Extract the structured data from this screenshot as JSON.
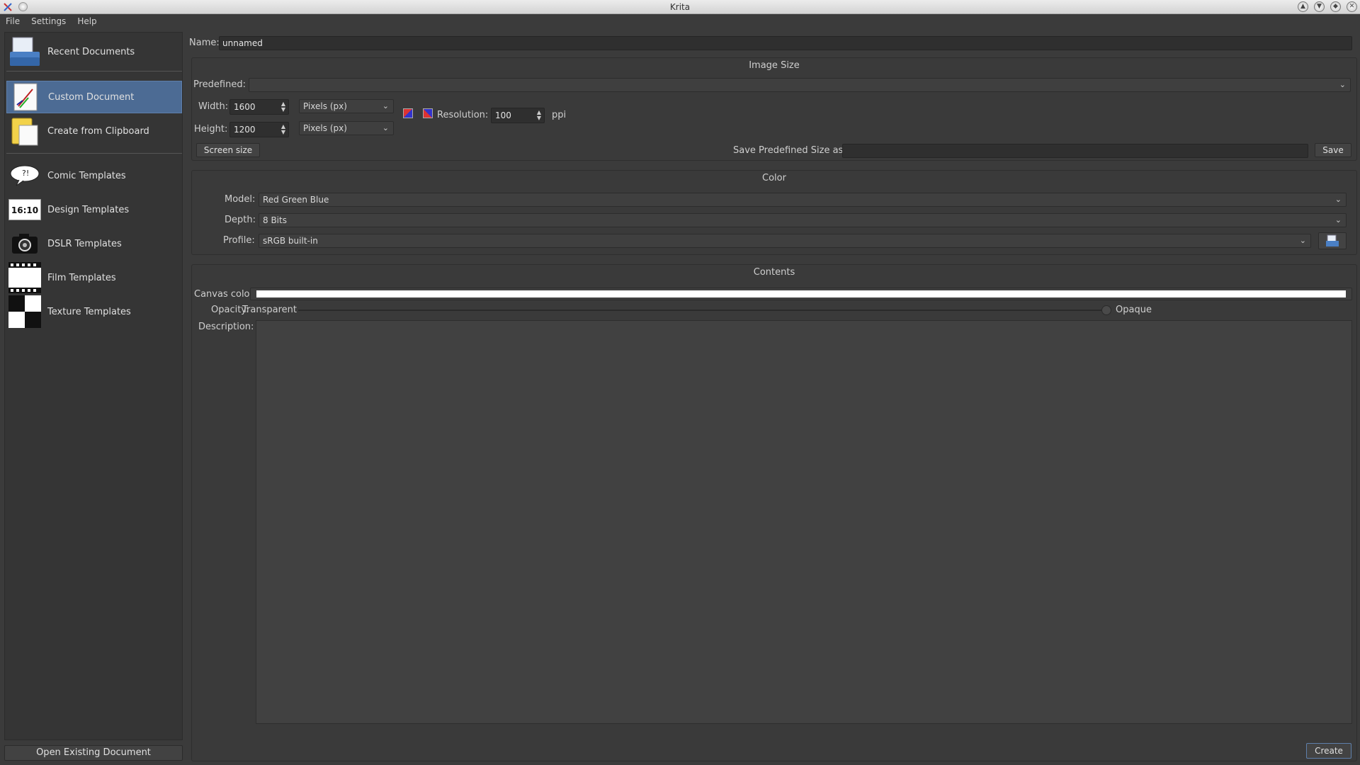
{
  "window": {
    "title": "Krita"
  },
  "menu": [
    "File",
    "Settings",
    "Help"
  ],
  "sidebar": {
    "items": [
      {
        "label": "Recent Documents",
        "icon": "documents-icon"
      },
      {
        "label": "Custom Document",
        "icon": "custom-document-icon",
        "selected": true
      },
      {
        "label": "Create from Clipboard",
        "icon": "clipboard-icon"
      },
      {
        "label": "Comic Templates",
        "icon": "speech-bubble-icon"
      },
      {
        "label": "Design Templates",
        "icon": "aspect-ratio-icon",
        "icon_text": "16:10"
      },
      {
        "label": "DSLR Templates",
        "icon": "camera-icon"
      },
      {
        "label": "Film Templates",
        "icon": "film-strip-icon"
      },
      {
        "label": "Texture Templates",
        "icon": "checkerboard-icon"
      }
    ],
    "open_existing": "Open Existing Document"
  },
  "form": {
    "name_label": "Name:",
    "name_value": "unnamed",
    "image_size": {
      "heading": "Image Size",
      "predefined_label": "Predefined:",
      "predefined_value": "",
      "width_label": "Width:",
      "width_value": "1600",
      "width_unit": "Pixels (px)",
      "height_label": "Height:",
      "height_value": "1200",
      "height_unit": "Pixels (px)",
      "resolution_label": "Resolution:",
      "resolution_value": "100",
      "resolution_unit": "ppi",
      "screen_size_button": "Screen size",
      "save_predefined_label": "Save Predefined Size as:",
      "save_predefined_value": "",
      "save_button": "Save"
    },
    "color": {
      "heading": "Color",
      "model_label": "Model:",
      "model_value": "Red Green Blue",
      "depth_label": "Depth:",
      "depth_value": "8 Bits",
      "profile_label": "Profile:",
      "profile_value": "sRGB built-in"
    },
    "contents": {
      "heading": "Contents",
      "canvas_color_label": "Canvas color:",
      "canvas_color": "#ffffff",
      "opacity_label": "Opacity:",
      "opacity_min": "Transparent",
      "opacity_max": "Opaque",
      "opacity_value": 1.0,
      "description_label": "Description:",
      "description_value": ""
    },
    "create_button": "Create"
  },
  "colors": {
    "accent": "#4c6b94",
    "background": "#3b3b3b"
  }
}
